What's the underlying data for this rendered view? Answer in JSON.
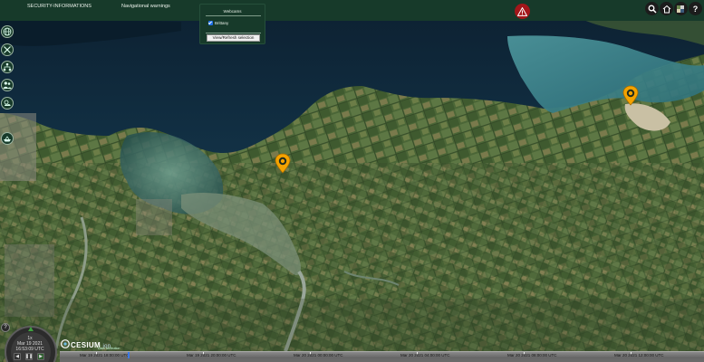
{
  "topbar": {
    "menu": [
      "SECURITY-INFORMATIONS",
      "Navigational warnings"
    ]
  },
  "icons": {
    "warning": "warning-triangle-icon",
    "search": "search-icon",
    "home": "home-icon",
    "layers": "layers-icon",
    "help": "help-icon"
  },
  "help_label": "?",
  "webcams_popup": {
    "title": "Webcams",
    "checkbox_label": "Brittany",
    "checked": true,
    "button_label": "View/Refresh selection"
  },
  "left_toolbar": [
    "globe-icon",
    "tools-icon",
    "network-icon",
    "people-icon",
    "weather-icon",
    "boat-icon"
  ],
  "clock": {
    "speed": "1x",
    "date": "Mar 19 2021",
    "time": "16:53:09 UTC",
    "buttons": [
      "◀",
      "❚❚",
      "▶"
    ],
    "help": "?"
  },
  "credits": {
    "brand": "CESIUM",
    "ion": "ion",
    "sub": "Data attribution"
  },
  "timeline": {
    "labels": [
      "Mar 19 2021 18:00:00 UTC",
      "Mar 19 2021 20:00:00 UTC",
      "Mar 20 2021 00:00:00 UTC",
      "Mar 20 2021 04:00:00 UTC",
      "Mar 20 2021 08:00:00 UTC",
      "Mar 20 2021 12:00:00 UTC"
    ]
  },
  "colors": {
    "bar": "#173a2a",
    "marker": "#f4a300",
    "warning": "#a3161a",
    "sea_deep": "#0c2230",
    "land": "#4a6534"
  }
}
